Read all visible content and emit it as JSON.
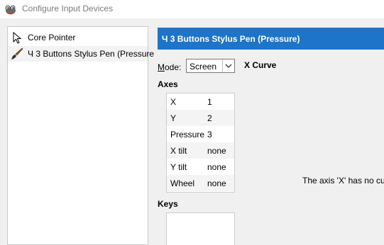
{
  "window": {
    "title": "Configure Input Devices",
    "icon": "gimp-icon"
  },
  "devices": [
    {
      "label": "Core Pointer",
      "icon": "pointer-arrow-icon"
    },
    {
      "label": "Ч 3 Buttons Stylus Pen (Pressure",
      "icon": "paintbrush-icon",
      "selected": true
    }
  ],
  "panel": {
    "header": "Ч 3 Buttons Stylus Pen (Pressure)",
    "header_color": "#1e74c8",
    "mode_label": "Mode:",
    "mode_value": "Screen",
    "curve_label": "X Curve",
    "axes_label": "Axes",
    "axes": [
      {
        "name": "X",
        "value": "1"
      },
      {
        "name": "Y",
        "value": "2"
      },
      {
        "name": "Pressure",
        "value": "3"
      },
      {
        "name": "X tilt",
        "value": "none"
      },
      {
        "name": "Y tilt",
        "value": "none"
      },
      {
        "name": "Wheel",
        "value": "none"
      }
    ],
    "keys_label": "Keys",
    "axis_message": "The axis 'X' has no cur"
  }
}
